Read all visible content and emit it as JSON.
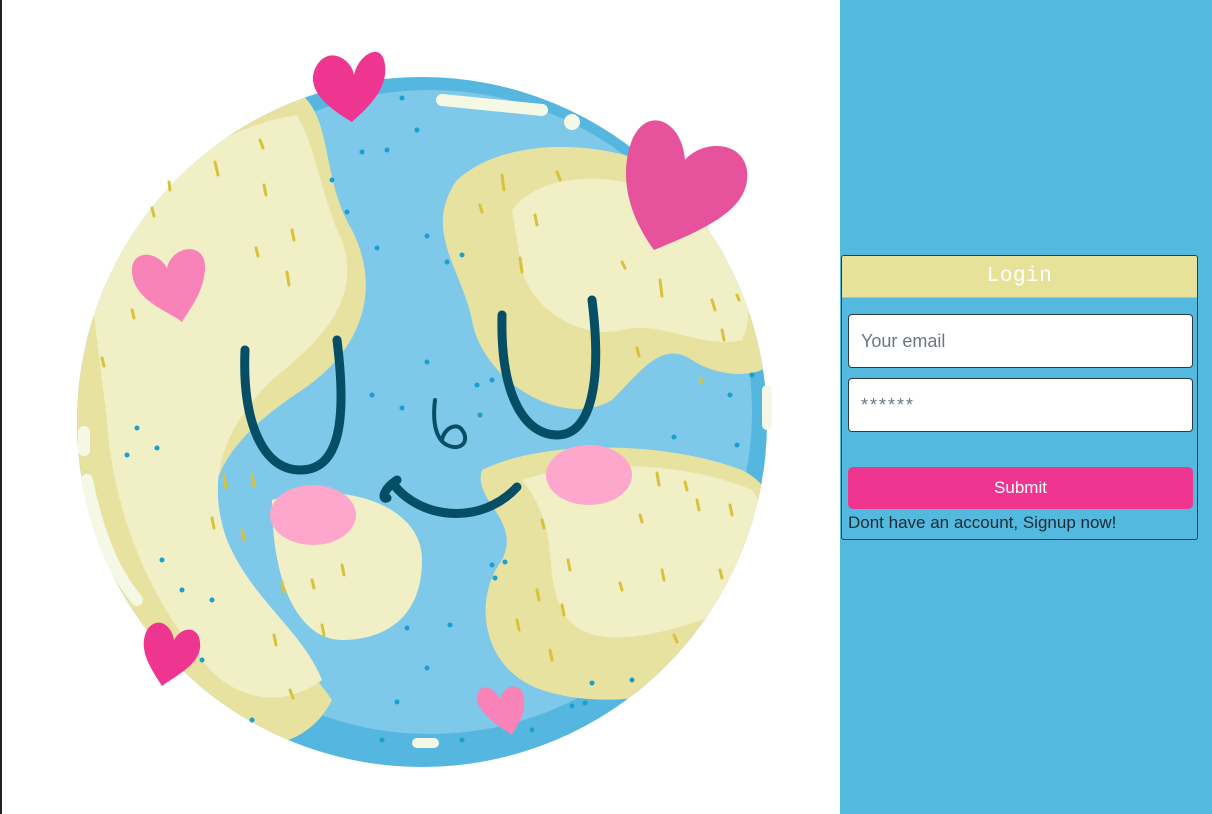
{
  "illustration": {
    "icon": "smiling-earth-with-hearts",
    "colors": {
      "ocean": "#7ec8e9",
      "ocean_dark": "#55b7df",
      "land": "#f0efc6",
      "land_shade": "#e7e2a0",
      "heart": "#ee3690",
      "heart_light": "#f783b9",
      "cheek": "#fda7cc",
      "face": "#064d66"
    }
  },
  "sidebar": {
    "background": "#54b9df"
  },
  "login": {
    "title": "Login",
    "email_placeholder": "Your email",
    "password_placeholder": "******",
    "submit_label": "Submit",
    "signup_text": "Dont have an account, Signup now!",
    "header_color": "#e6e29a",
    "submit_color": "#ee3690"
  }
}
